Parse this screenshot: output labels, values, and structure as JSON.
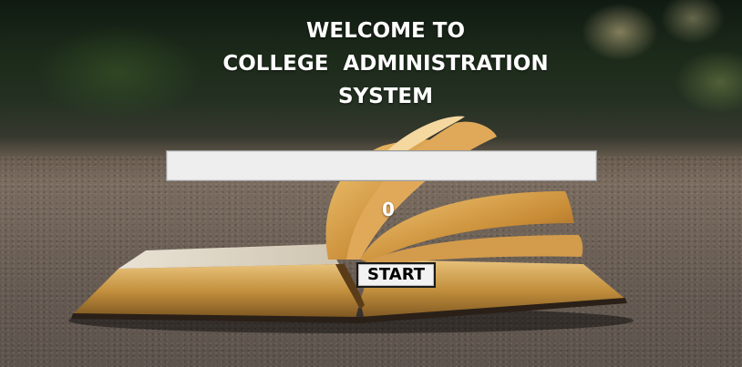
{
  "title": {
    "line1": "WELCOME TO",
    "line2": "COLLEGE  ADMINISTRATION",
    "line3": "SYSTEM"
  },
  "progress": {
    "value": 0,
    "label": "0"
  },
  "start_button": {
    "label": "START"
  },
  "colors": {
    "title_text": "#ffffff",
    "progress_track": "#eeeeee",
    "button_bg": "#f2f2f2"
  }
}
